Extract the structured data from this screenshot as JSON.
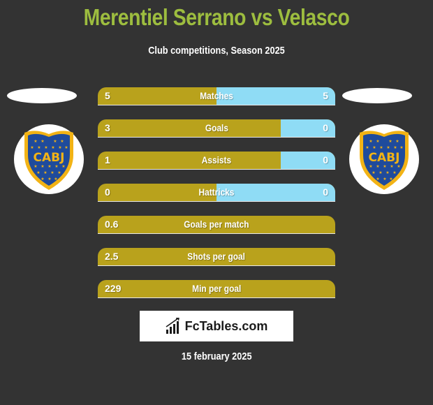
{
  "header": {
    "title": "Merentiel Serrano vs Velasco",
    "subtitle": "Club competitions, Season 2025"
  },
  "colors": {
    "background": "#333333",
    "title": "#9dbd3f",
    "left_bar": "#b9a21c",
    "right_bar": "#8fdcf5"
  },
  "players": {
    "left": {
      "club_badge": "CABJ",
      "badge_icon": "boca-juniors-crest-icon"
    },
    "right": {
      "club_badge": "CABJ",
      "badge_icon": "boca-juniors-crest-icon"
    }
  },
  "stats": [
    {
      "label": "Matches",
      "left": "5",
      "right": "5",
      "right_share": 0.5
    },
    {
      "label": "Goals",
      "left": "3",
      "right": "0",
      "right_share": 0.23
    },
    {
      "label": "Assists",
      "left": "1",
      "right": "0",
      "right_share": 0.23
    },
    {
      "label": "Hattricks",
      "left": "0",
      "right": "0",
      "right_share": 0.5
    },
    {
      "label": "Goals per match",
      "left": "0.6",
      "right": "",
      "right_share": 0
    },
    {
      "label": "Shots per goal",
      "left": "2.5",
      "right": "",
      "right_share": 0
    },
    {
      "label": "Min per goal",
      "left": "229",
      "right": "",
      "right_share": 0
    }
  ],
  "footer": {
    "logo_text": "FcTables.com",
    "logo_icon": "bar-chart-icon",
    "date": "15 february 2025"
  }
}
